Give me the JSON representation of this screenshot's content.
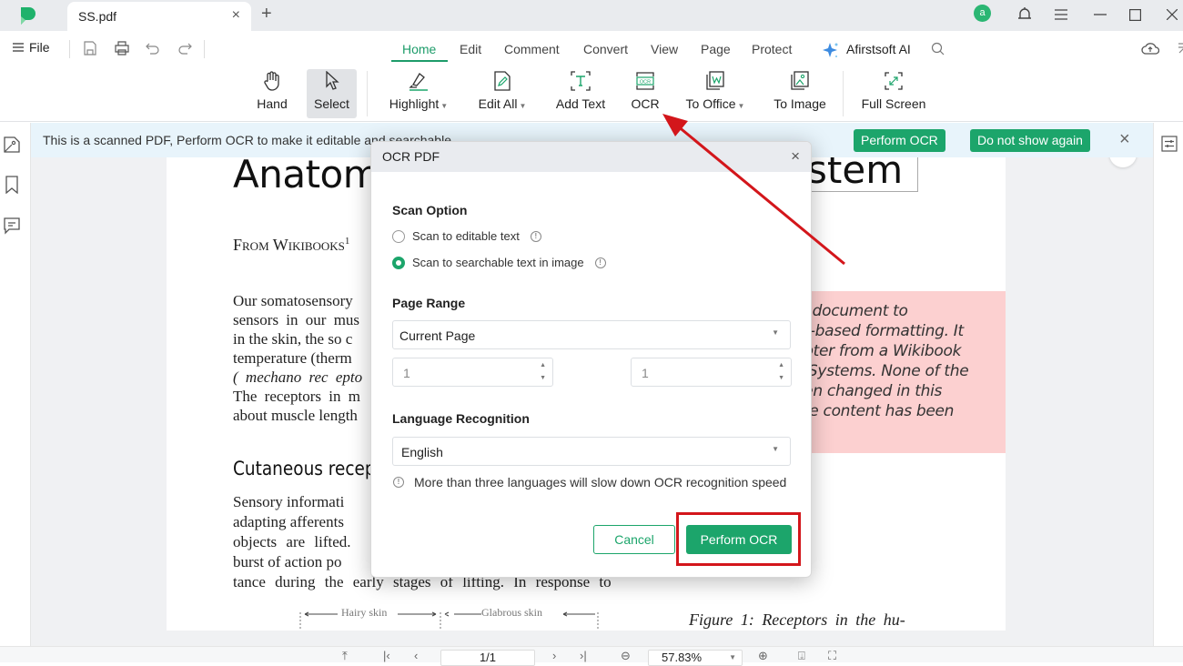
{
  "titlebar": {
    "tab_label": "SS.pdf",
    "tab_close_icon": "×",
    "new_tab_icon": "+",
    "avatar_letter": "a",
    "colors": {
      "brand": "#2bb673",
      "accent": "#1ca56b"
    }
  },
  "menubar": {
    "file_label": "File",
    "tabs": [
      {
        "label": "Home",
        "active": true
      },
      {
        "label": "Edit"
      },
      {
        "label": "Comment"
      },
      {
        "label": "Convert"
      },
      {
        "label": "View"
      },
      {
        "label": "Page"
      },
      {
        "label": "Protect"
      }
    ],
    "ai_label": "Afirstsoft AI"
  },
  "toolbar": {
    "hand": "Hand",
    "select": "Select",
    "highlight": "Highlight",
    "edit_all": "Edit All",
    "add_text": "Add Text",
    "ocr": "OCR",
    "to_office": "To Office",
    "to_image": "To Image",
    "full_screen": "Full Screen",
    "caret": "▼"
  },
  "banner": {
    "message": "This is a scanned PDF, Perform OCR to make it editable and searchable",
    "perform_ocr": "Perform OCR",
    "do_not_show": "Do not show again",
    "close": "×"
  },
  "document": {
    "title_start": "Anatomy",
    "title_end": "stem",
    "from": "From Wikibooks",
    "from_sup": "1",
    "body_lines": [
      "Our somatosensory",
      "sensors in our mus",
      "in the skin, the so c",
      "temperature (therm",
      "( mechano rec epto",
      "The receptors in m",
      "about muscle length"
    ],
    "heading2": "Cutaneous recept",
    "body2_lines": [
      "Sensory informati",
      "adapting afferents",
      "objects are lifted.",
      "burst of action po"
    ],
    "last_line": "tance during the early stages of lifting. In response to",
    "figure_labels": {
      "hairy": "Hairy skin",
      "glabrous": "Glabrous skin"
    },
    "figure_caption": "Figure 1:  Receptors in the hu-",
    "pink_lines": [
      "le document to",
      "re-based formatting. It",
      "apter from a Wikibook",
      "y Systems. None of the",
      "een changed in this",
      "me content has been"
    ]
  },
  "dialog": {
    "title": "OCR PDF",
    "close": "×",
    "scan_option_label": "Scan Option",
    "scan_options": [
      {
        "label": "Scan to editable text",
        "checked": false
      },
      {
        "label": "Scan to searchable text in image",
        "checked": true
      }
    ],
    "page_range_label": "Page Range",
    "page_range_value": "Current Page",
    "page_from": "1",
    "page_to": "1",
    "language_label": "Language Recognition",
    "language_value": "English",
    "language_note": "More than three languages will slow down OCR recognition speed",
    "cancel": "Cancel",
    "perform": "Perform OCR"
  },
  "statusbar": {
    "page_indicator": "1/1",
    "zoom": "57.83%"
  }
}
